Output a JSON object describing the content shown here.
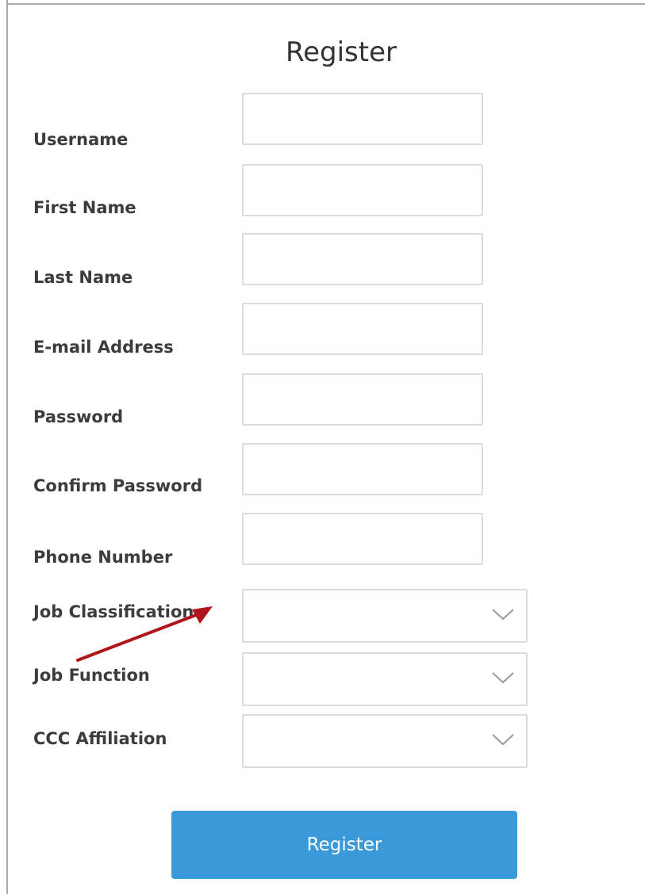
{
  "form": {
    "title": "Register",
    "fields": [
      {
        "label": "Username",
        "value": ""
      },
      {
        "label": "First Name",
        "value": ""
      },
      {
        "label": "Last Name",
        "value": ""
      },
      {
        "label": "E-mail Address",
        "value": ""
      },
      {
        "label": "Password",
        "value": ""
      },
      {
        "label": "Confirm Password",
        "value": ""
      },
      {
        "label": "Phone Number",
        "value": ""
      }
    ],
    "selects": [
      {
        "label": "Job Classification",
        "value": ""
      },
      {
        "label": "Job Function",
        "value": ""
      },
      {
        "label": "CCC Affiliation",
        "value": ""
      }
    ],
    "submit_label": "Register"
  },
  "colors": {
    "button_bg": "#3a9ad9",
    "arrow": "#b0151b",
    "field_border": "#dcdcdc",
    "label_text": "#3c3c3c"
  }
}
